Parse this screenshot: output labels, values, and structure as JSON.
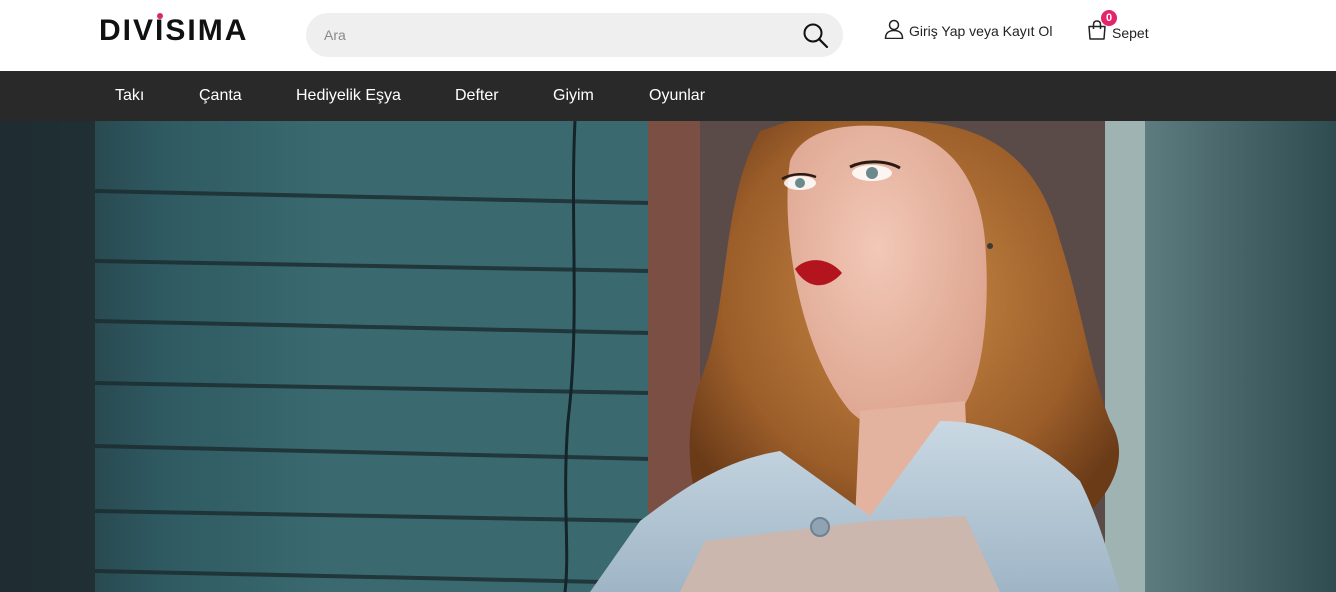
{
  "brand": {
    "name": "DIVISIMA",
    "accent": "#e3246b"
  },
  "search": {
    "placeholder": "Ara",
    "value": "",
    "icon": "search-icon"
  },
  "account": {
    "label": "Giriş Yap veya Kayıt Ol",
    "icon": "user-icon"
  },
  "cart": {
    "label": "Sepet",
    "count": "0",
    "icon": "shopping-bag-icon"
  },
  "nav": {
    "background": "#292929",
    "items": [
      {
        "label": "Takı"
      },
      {
        "label": "Çanta"
      },
      {
        "label": "Hediyelik Eşya"
      },
      {
        "label": "Defter"
      },
      {
        "label": "Giyim"
      },
      {
        "label": "Oyunlar"
      }
    ]
  },
  "hero": {
    "subject": "photo-banner"
  }
}
